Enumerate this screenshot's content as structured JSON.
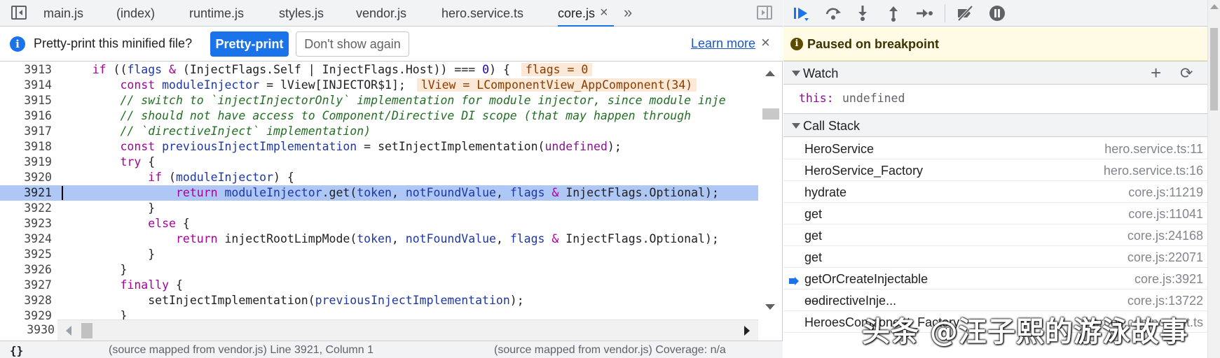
{
  "editor": {
    "tabs": [
      "main.js",
      "(index)",
      "runtime.js",
      "styles.js",
      "vendor.js",
      "hero.service.ts",
      "core.js"
    ],
    "active_tab": "core.js",
    "tab_close": "×",
    "tab_more": "»"
  },
  "infobar": {
    "message": "Pretty-print this minified file?",
    "pretty_print": "Pretty-print",
    "dont_show": "Don't show again",
    "learn_more": "Learn more",
    "close": "×"
  },
  "code": {
    "highlighted_line": 3921,
    "lines": [
      {
        "n": "3913",
        "t": "    if ((flags & (InjectFlags.Self | InjectFlags.Host)) === 0) {"
      },
      {
        "n": "3914",
        "t": "        const moduleInjector = lView[INJECTOR$1];"
      },
      {
        "n": "3915",
        "t": "        // switch to `injectInjectorOnly` implementation for module injector, since module inje"
      },
      {
        "n": "3916",
        "t": "        // should not have access to Component/Directive DI scope (that may happen through"
      },
      {
        "n": "3917",
        "t": "        // `directiveInject` implementation)"
      },
      {
        "n": "3918",
        "t": "        const previousInjectImplementation = setInjectImplementation(undefined);"
      },
      {
        "n": "3919",
        "t": "        try {"
      },
      {
        "n": "3920",
        "t": "            if (moduleInjector) {"
      },
      {
        "n": "3921",
        "t": "                return moduleInjector.get(token, notFoundValue, flags & InjectFlags.Optional);"
      },
      {
        "n": "3922",
        "t": "            }"
      },
      {
        "n": "3923",
        "t": "            else {"
      },
      {
        "n": "3924",
        "t": "                return injectRootLimpMode(token, notFoundValue, flags & InjectFlags.Optional);"
      },
      {
        "n": "3925",
        "t": "            }"
      },
      {
        "n": "3926",
        "t": "        }"
      },
      {
        "n": "3927",
        "t": "        finally {"
      },
      {
        "n": "3928",
        "t": "            setInjectImplementation(previousInjectImplementation);"
      },
      {
        "n": "3929",
        "t": "        }"
      }
    ],
    "last_line_number": "3930",
    "inline_values": {
      "flags": "flags = 0",
      "lview": "lView = LComponentView_AppComponent(34)"
    }
  },
  "status": {
    "brace": "{}",
    "left": "(source mapped from vendor.js)  Line 3921, Column 1",
    "right": "(source mapped from vendor.js)  Coverage: n/a"
  },
  "debugger": {
    "paused_message": "Paused on breakpoint",
    "watch": {
      "title": "Watch",
      "key": "this:",
      "value": "undefined"
    },
    "call_stack": {
      "title": "Call Stack",
      "frames": [
        {
          "name": "HeroService",
          "loc": "hero.service.ts:11",
          "current": false
        },
        {
          "name": "HeroService_Factory",
          "loc": "hero.service.ts:16",
          "current": false
        },
        {
          "name": "hydrate",
          "loc": "core.js:11219",
          "current": false
        },
        {
          "name": "get",
          "loc": "core.js:11041",
          "current": false
        },
        {
          "name": "get",
          "loc": "core.js:24168",
          "current": false
        },
        {
          "name": "get",
          "loc": "core.js:22071",
          "current": false
        },
        {
          "name": "getOrCreateInjectable",
          "loc": "core.js:3921",
          "current": true
        },
        {
          "name": "ɵɵdirectiveInje...",
          "loc": "core.js:13722",
          "current": false
        },
        {
          "name": "HeroesComponent_Factory",
          "loc": "heroes.component.ts",
          "current": false
        }
      ]
    }
  },
  "watermark": "头条 @汪子熙的游泳故事",
  "colors": {
    "accent": "#1a73e8",
    "highlight_line": "#aec7f5",
    "paused_bg": "#fffbe5",
    "inline_value_bg": "#fce8d7"
  },
  "icons": [
    "panel-toggle-icon",
    "info-icon",
    "resume-icon",
    "step-over-icon",
    "step-into-icon",
    "step-out-icon",
    "step-icon",
    "deactivate-breakpoints-icon",
    "pause-on-exceptions-icon",
    "add-icon",
    "refresh-icon",
    "current-frame-arrow-icon"
  ]
}
